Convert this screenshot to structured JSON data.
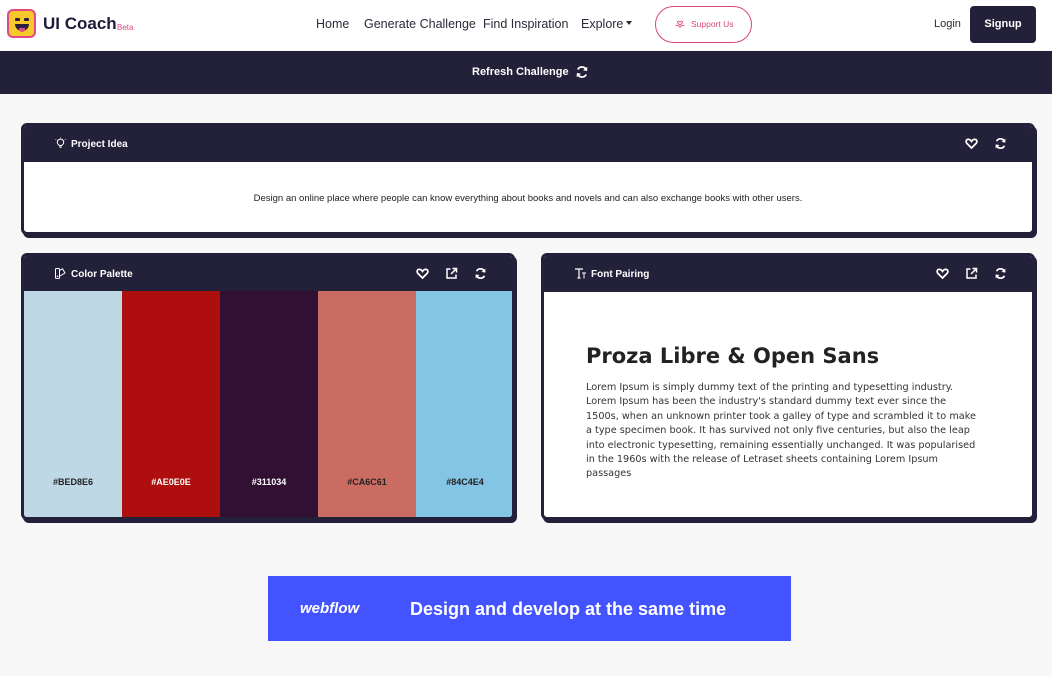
{
  "nav": {
    "brand": "UI Coach",
    "beta": "Beta",
    "links": [
      "Home",
      "Generate Challenge",
      "Find Inspiration",
      "Explore"
    ],
    "support_label": "Support Us",
    "login_label": "Login",
    "signup_label": "Signup"
  },
  "refresh": {
    "label": "Refresh Challenge"
  },
  "project": {
    "title": "Project Idea",
    "text": "Design an online place where people can know everything about books and novels and can also exchange books with other users."
  },
  "palette": {
    "title": "Color Palette",
    "swatches": [
      {
        "hex": "#BED8E6",
        "label_color": "#222222"
      },
      {
        "hex": "#AE0E0E",
        "label_color": "#ffffff"
      },
      {
        "hex": "#311034",
        "label_color": "#ffffff"
      },
      {
        "hex": "#CA6C61",
        "label_color": "#222222"
      },
      {
        "hex": "#84C4E4",
        "label_color": "#222222"
      }
    ]
  },
  "font": {
    "title": "Font Pairing",
    "pairing": "Proza Libre & Open Sans",
    "sample": "Lorem Ipsum is simply dummy text of the printing and typesetting industry. Lorem Ipsum has been the industry's standard dummy text ever since the 1500s, when an unknown printer took a galley of type and scrambled it to make a type specimen book. It has survived not only five centuries, but also the leap into electronic typesetting, remaining essentially unchanged. It was popularised in the 1960s with the release of Letraset sheets containing Lorem Ipsum passages"
  },
  "ad": {
    "logo": "webflow",
    "text": "Design and develop at the same time"
  },
  "colors": {
    "dark": "#232039",
    "accent": "#d9457f",
    "ad_blue": "#4353ff"
  }
}
